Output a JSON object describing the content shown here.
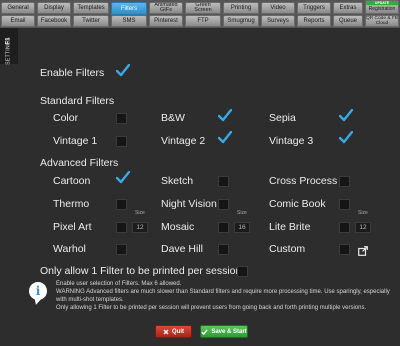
{
  "tabs": {
    "row1": [
      {
        "label": "General"
      },
      {
        "label": "Display"
      },
      {
        "label": "Templates"
      },
      {
        "label": "Filters",
        "active": true
      },
      {
        "label": "Animated GIFs"
      },
      {
        "label": "Green Screen"
      },
      {
        "label": "Printing"
      },
      {
        "label": "Video"
      },
      {
        "label": "Triggers"
      },
      {
        "label": "Extras"
      },
      {
        "label": "Registration",
        "badge": "UPDATE"
      }
    ],
    "row2": [
      {
        "label": "Email"
      },
      {
        "label": "Facebook"
      },
      {
        "label": "Twitter"
      },
      {
        "label": "SMS"
      },
      {
        "label": "Pinterest"
      },
      {
        "label": "FTP"
      },
      {
        "label": "Smugmug"
      },
      {
        "label": "Surveys"
      },
      {
        "label": "Reports"
      },
      {
        "label": "Queue"
      },
      {
        "label": "QR Code & FB Cloud"
      }
    ]
  },
  "side_tab": {
    "key": "F1",
    "label": "SETTINGS"
  },
  "enable_filters": {
    "label": "Enable Filters",
    "checked": true
  },
  "standard": {
    "heading": "Standard Filters",
    "items": [
      {
        "label": "Color",
        "checked": false
      },
      {
        "label": "B&W",
        "checked": true
      },
      {
        "label": "Sepia",
        "checked": true
      },
      {
        "label": "Vintage 1",
        "checked": false
      },
      {
        "label": "Vintage 2",
        "checked": true
      },
      {
        "label": "Vintage 3",
        "checked": true
      }
    ]
  },
  "advanced": {
    "heading": "Advanced Filters",
    "size_label": "Size",
    "items": [
      {
        "label": "Cartoon",
        "checked": true
      },
      {
        "label": "Sketch",
        "checked": false
      },
      {
        "label": "Cross Process",
        "checked": false
      },
      {
        "label": "Thermo",
        "checked": false
      },
      {
        "label": "Night Vision",
        "checked": false
      },
      {
        "label": "Comic Book",
        "checked": false
      },
      {
        "label": "Pixel Art",
        "checked": false,
        "size": "12"
      },
      {
        "label": "Mosaic",
        "checked": false,
        "size": "16"
      },
      {
        "label": "Lite Brite",
        "checked": false,
        "size": "12"
      },
      {
        "label": "Warhol",
        "checked": false
      },
      {
        "label": "Dave Hill",
        "checked": false
      },
      {
        "label": "Custom",
        "checked": false,
        "icon": "external-link-icon"
      }
    ]
  },
  "one_filter": {
    "label": "Only allow 1 Filter to be printed per session",
    "checked": false
  },
  "info": {
    "line1": "Enable user selection of Filters.  Max 6 allowed.",
    "line2": "WARNING Advanced filters are much slower than Standard filters and require more processing time.  Use sparingly, especially with multi-shot templates.",
    "line3": "Only allowing 1 Filter to be printed per session will prevent users from going back and forth printing multiple versions."
  },
  "buttons": {
    "quit": "Quit",
    "save": "Save & Start"
  },
  "colors": {
    "accent": "#2e8ec8",
    "check": "#39a9e6",
    "quit": "#c0392b",
    "save": "#3aa63f"
  }
}
